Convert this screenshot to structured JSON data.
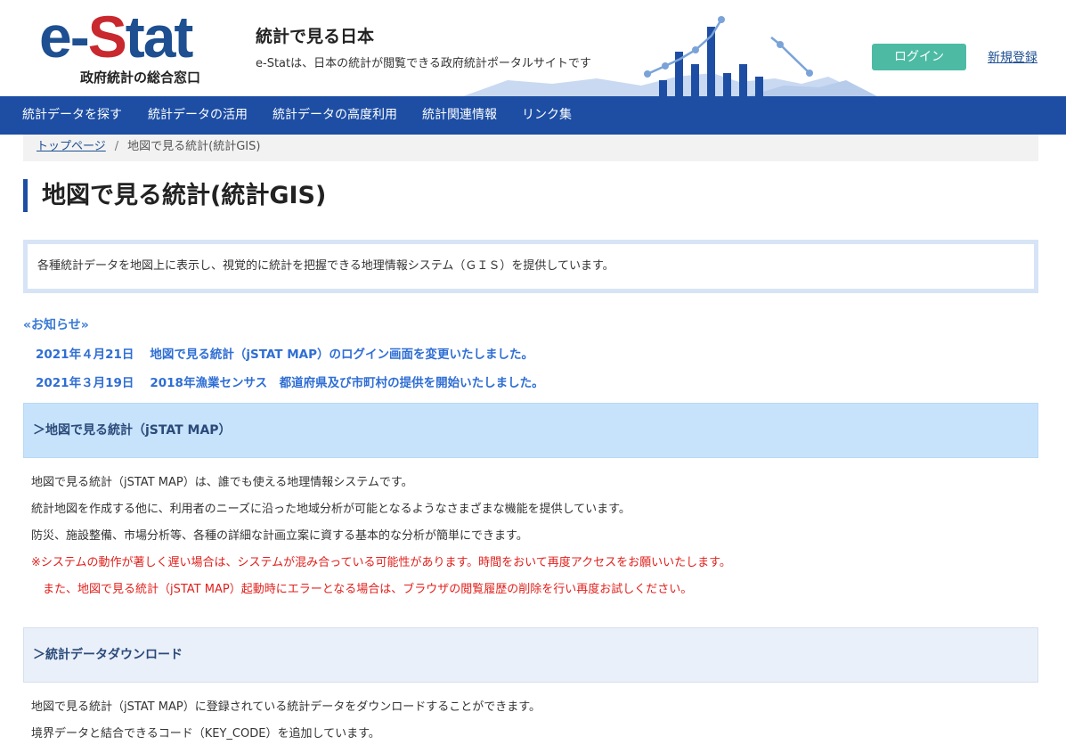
{
  "header": {
    "logo_text_e": "e-",
    "logo_text_s": "S",
    "logo_text_tat": "tat",
    "logo_sub": "政府統計の総合窓口",
    "site_title": "統計で見る日本",
    "site_desc": "e-Statは、日本の統計が閲覧できる政府統計ポータルサイトです",
    "login_label": "ログイン",
    "signup_label": "新規登録",
    "colors": {
      "brand_blue": "#1d4f91",
      "brand_red": "#c8282e",
      "login_green": "#4dbba4"
    }
  },
  "nav": {
    "items": [
      {
        "label": "統計データを探す"
      },
      {
        "label": "統計データの活用"
      },
      {
        "label": "統計データの高度利用"
      },
      {
        "label": "統計関連情報"
      },
      {
        "label": "リンク集"
      }
    ],
    "color": "#1d4ea4"
  },
  "breadcrumb": {
    "home": "トップページ",
    "separator": "/",
    "current": "地図で見る統計(統計GIS)"
  },
  "page_title": "地図で見る統計(統計GIS)",
  "intro": "各種統計データを地図上に表示し、視覚的に統計を把握できる地理情報システム（ＧＩＳ）を提供しています。",
  "notices": {
    "heading": "«お知らせ»",
    "items": [
      {
        "date": "2021年４月21日",
        "text": "地図で見る統計（jSTAT MAP）のログイン画面を変更いたしました。"
      },
      {
        "date": "2021年３月19日",
        "text": "2018年漁業センサス　都道府県及び市町村の提供を開始いたしました。"
      }
    ]
  },
  "sections": [
    {
      "heading": "＞地図で見る統計（jSTAT MAP）",
      "lines": [
        "地図で見る統計（jSTAT MAP）は、誰でも使える地理情報システムです。",
        "統計地図を作成する他に、利用者のニーズに沿った地域分析が可能となるようなさまざまな機能を提供しています。",
        "防災、施設整備、市場分析等、各種の詳細な計画立案に資する基本的な分析が簡単にできます。"
      ],
      "warnings": [
        "※システムの動作が著しく遅い場合は、システムが混み合っている可能性があります。時間をおいて再度アクセスをお願いいたします。",
        "　また、地図で見る統計（jSTAT MAP）起動時にエラーとなる場合は、ブラウザの閲覧履歴の削除を行い再度お試しください。"
      ]
    },
    {
      "heading": "＞統計データダウンロード",
      "lines": [
        "地図で見る統計（jSTAT MAP）に登録されている統計データをダウンロードすることができます。",
        "境界データと結合できるコード（KEY_CODE）を追加しています。"
      ]
    }
  ]
}
